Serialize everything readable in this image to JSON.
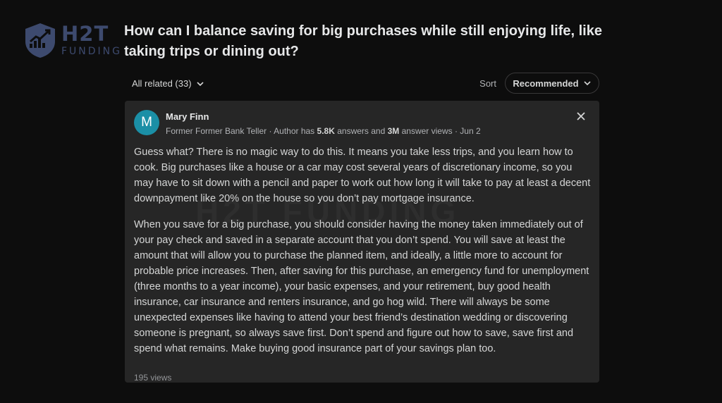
{
  "logo": {
    "main": "H2T",
    "sub": "FUNDING"
  },
  "question": {
    "title": "How can I balance saving for big purchases while still enjoying life, like taking trips or dining out?"
  },
  "filter": {
    "all_related": "All related (33)",
    "sort_label": "Sort",
    "sort_value": "Recommended"
  },
  "answer": {
    "avatar_letter": "M",
    "author_name": "Mary Finn",
    "cred_prefix": "Former Former Bank Teller · Author has ",
    "answers_count": "5.8K",
    "cred_mid": " answers and ",
    "views_count": "3M",
    "cred_suffix": " answer views · Jun 2",
    "watermark": "H2T FUNDING",
    "paragraphs": [
      "Guess what? There is no magic way to do this. It means you take less trips, and you learn how to cook. Big purchases like a house or a car may cost several years of discretionary income, so you may have to sit down with a pencil and paper to work out how long it will take to pay at least a decent downpayment like 20% on the house so you don’t pay mortgage insurance.",
      "When you save for a big purchase, you should consider having the money taken immediately out of your pay check and saved in a separate account that you don’t spend. You will save at least the amount that will allow you to purchase the planned item, and ideally, a little more to account for probable price increases. Then, after saving for this purchase, an emergency fund for unemployment (three months to a year income), your basic expenses, and your retirement, buy good health insurance, car insurance and renters insurance, and go hog wild. There will always be some unexpected expenses like having to attend your best friend’s destination wedding or discovering someone is pregnant, so always save first. Don’t spend and figure out how to save, save first and spend what remains. Make buying good insurance part of your savings plan too."
    ],
    "views": "195 views"
  },
  "colors": {
    "background": "#0d0d0d",
    "card": "#262626",
    "avatar": "#1b8fa6",
    "logo": "#3d4a6e"
  }
}
